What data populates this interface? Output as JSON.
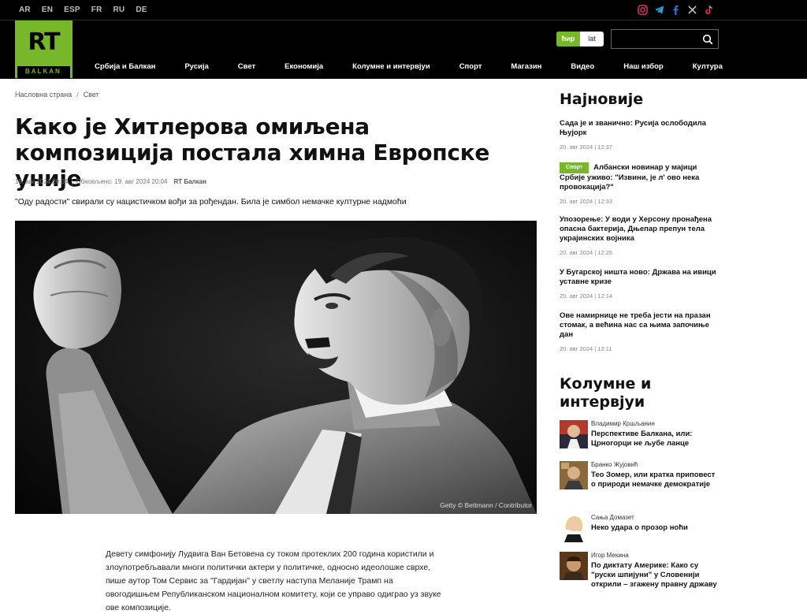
{
  "topbar": {
    "languages": [
      "AR",
      "EN",
      "ESP",
      "FR",
      "RU",
      "DE"
    ],
    "socials": [
      "instagram-icon",
      "telegram-icon",
      "facebook-icon",
      "x-icon",
      "tiktok-icon"
    ]
  },
  "header": {
    "logo_text": "RT",
    "logo_sub": "BALKAN",
    "script_cyr": "ћир",
    "script_lat": "lat",
    "nav": [
      "Србија и Балкан",
      "Русија",
      "Свет",
      "Економија",
      "Колумне и интервјуи",
      "Спорт",
      "Магазин",
      "Видео",
      "Наш избор",
      "Култура"
    ]
  },
  "breadcrumb": {
    "home": "Насловна страна",
    "section": "Свет"
  },
  "article": {
    "title": "Како је Хитлерова омиљена композиција постала химна Европске уније",
    "published": "19. авг 2024 20:04",
    "updated": "Обновљено: 19. авг 2024 20:04",
    "source": "RT Балкан",
    "lede": "\"Оду радости\" свирали су нацистичком вођи за рођендан. Била је симбол немачке културне надмоћи",
    "image_caption": "Getty © Bettmann / Contributor",
    "body": "Девету симфонију Лудвига Ван Бетовена су током протеклих 200 година користили и злоупотребљавали многи политички актери у политичке, односно идеолошке сврхе, пише аутор Том Сервис за \"Гардијан\" у светлу наступа Меланије Трамп на овогодишњем Републиканском националном комитету, који се управо одиграо уз звуке ове композиције."
  },
  "sidebar": {
    "latest_title": "Најновије",
    "latest": [
      {
        "title": "Сада је и званично: Русија ослободила Њујорк",
        "date": "20. авг 2024 | 12:37",
        "badge": ""
      },
      {
        "title": "Албански новинар у мајици Србије уживо: \"Извини, је л' ово нека провокација?\"",
        "date": "20. авг 2024 | 12:33",
        "badge": "Спорт"
      },
      {
        "title": "Упозорење: У води у Херсону пронађена опасна бактерија, Дњепар препун тела украјинских војника",
        "date": "20. авг 2024 | 12:25",
        "badge": ""
      },
      {
        "title": "У Бугарској ништа ново: Држава на ивици уставне кризе",
        "date": "20. авг 2024 | 12:14",
        "badge": ""
      },
      {
        "title": "Ове намирнице не треба јести на празан стомак, а већина нас са њима започиње дан",
        "date": "20. авг 2024 | 12:11",
        "badge": ""
      }
    ],
    "columns_title": "Колумне и интервјуи",
    "columns": [
      {
        "author": "Владимир Кршљанин",
        "title": "Перспективе Балкана, или: Црногорци не љубе ланце",
        "thumb": "#b23a2a"
      },
      {
        "author": "Бранко Жујовић",
        "title": "Тео Зомер, или кратка приповест о природи немачке демократије",
        "thumb": "#8a6a3a"
      },
      {
        "author": "Сања Домазет",
        "title": "Неко удара о прозор ноћи",
        "thumb": "#d9d2c8"
      },
      {
        "author": "Игор Мекина",
        "title": "По диктату Америке: Како су \"руски шпијуни\" у Словенији открили – згажену правну државу",
        "thumb": "#5a3a1a"
      }
    ]
  },
  "colors": {
    "brand_green": "#76b82a",
    "header_bg": "#000000"
  }
}
